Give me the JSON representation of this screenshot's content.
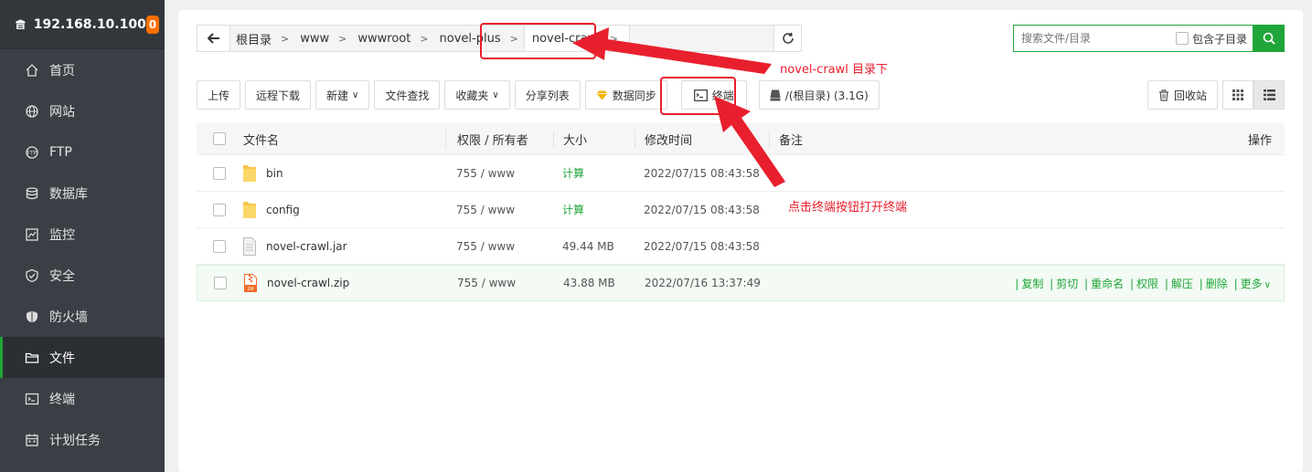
{
  "sidebar": {
    "host": "192.168.10.100",
    "badge": "0",
    "items": [
      {
        "label": "首页",
        "icon": "home-icon"
      },
      {
        "label": "网站",
        "icon": "globe-icon"
      },
      {
        "label": "FTP",
        "icon": "ftp-icon"
      },
      {
        "label": "数据库",
        "icon": "database-icon"
      },
      {
        "label": "监控",
        "icon": "monitor-icon"
      },
      {
        "label": "安全",
        "icon": "shield-check-icon"
      },
      {
        "label": "防火墙",
        "icon": "shield-icon"
      },
      {
        "label": "文件",
        "icon": "folder-icon",
        "active": true
      },
      {
        "label": "终端",
        "icon": "terminal-icon"
      },
      {
        "label": "计划任务",
        "icon": "calendar-icon"
      }
    ]
  },
  "path": {
    "crumbs": [
      "根目录",
      "www",
      "wwwroot",
      "novel-plus",
      "novel-crawl"
    ]
  },
  "search": {
    "placeholder": "搜索文件/目录",
    "include_sub_label": "包含子目录"
  },
  "toolbar": {
    "upload": "上传",
    "remote_download": "远程下载",
    "new": "新建",
    "file_search": "文件查找",
    "favorites": "收藏夹",
    "share_list": "分享列表",
    "data_sync": "数据同步",
    "terminal": "终端",
    "disk": "/(根目录) (3.1G)",
    "recycle": "回收站"
  },
  "table": {
    "headers": {
      "name": "文件名",
      "perm": "权限 / 所有者",
      "size": "大小",
      "time": "修改时间",
      "note": "备注",
      "ops": "操作"
    },
    "rows": [
      {
        "name": "bin",
        "type": "folder",
        "perm": "755 / www",
        "size": "计算",
        "time": "2022/07/15 08:43:58"
      },
      {
        "name": "config",
        "type": "folder",
        "perm": "755 / www",
        "size": "计算",
        "time": "2022/07/15 08:43:58"
      },
      {
        "name": "novel-crawl.jar",
        "type": "file",
        "perm": "755 / www",
        "size": "49.44 MB",
        "time": "2022/07/15 08:43:58"
      },
      {
        "name": "novel-crawl.zip",
        "type": "zip",
        "perm": "755 / www",
        "size": "43.88 MB",
        "time": "2022/07/16 13:37:49"
      }
    ],
    "row_ops": [
      "复制",
      "剪切",
      "重命名",
      "权限",
      "解压",
      "删除",
      "更多"
    ]
  },
  "annotations": {
    "dir_note": "novel-crawl 目录下",
    "terminal_note": "点击终端按钮打开终端"
  },
  "colors": {
    "accent": "#20a53a",
    "annotation": "#e8202e",
    "sidebar_bg": "#3b3f45",
    "badge": "#ff6f00"
  }
}
